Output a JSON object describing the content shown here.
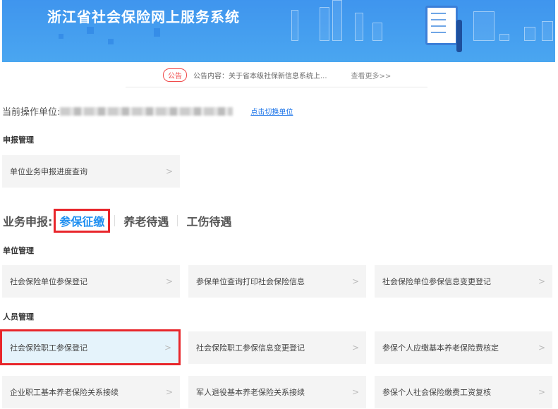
{
  "header": {
    "title": "浙江省社会保险网上服务系统"
  },
  "notice": {
    "badge": "公告",
    "text": "公告内容：关于省本级社保新信息系统上...",
    "more": "查看更多>>"
  },
  "operator": {
    "label": "当前操作单位:",
    "switch_link": "点击切换单位"
  },
  "declaration": {
    "title": "申报管理",
    "items": [
      {
        "label": "单位业务申报进度查询"
      }
    ]
  },
  "business": {
    "label": "业务申报:",
    "tabs": [
      {
        "label": "参保征缴",
        "active": true
      },
      {
        "label": "养老待遇"
      },
      {
        "label": "工伤待遇"
      }
    ]
  },
  "unit_mgmt": {
    "title": "单位管理",
    "items": [
      {
        "label": "社会保险单位参保登记"
      },
      {
        "label": "参保单位查询打印社会保险信息"
      },
      {
        "label": "社会保险单位参保信息变更登记"
      }
    ]
  },
  "person_mgmt": {
    "title": "人员管理",
    "items": [
      {
        "label": "社会保险职工参保登记"
      },
      {
        "label": "社会保险职工参保信息变更登记"
      },
      {
        "label": "参保个人应缴基本养老保险费核定"
      },
      {
        "label": "企业职工基本养老保险关系接续"
      },
      {
        "label": "军人退役基本养老保险关系接续"
      },
      {
        "label": "参保个人社会保险缴费工资复核"
      }
    ]
  },
  "arrow": ">",
  "colors": {
    "accent": "#1d8ef0",
    "highlight": "#e8262b"
  }
}
